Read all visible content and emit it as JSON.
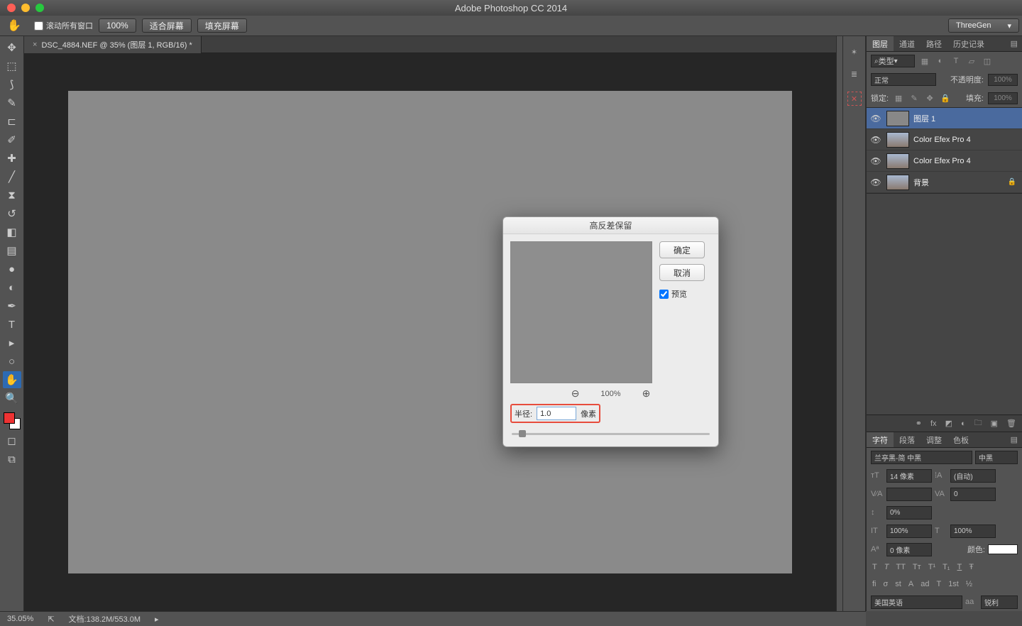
{
  "titlebar": {
    "app": "Adobe Photoshop CC 2014"
  },
  "optbar": {
    "scroll_all": "滚动所有窗口",
    "zoom": "100%",
    "fit": "适合屏幕",
    "fill": "填充屏幕",
    "workspace": "ThreeGen"
  },
  "tab": {
    "name": "DSC_4884.NEF @ 35% (图层 1, RGB/16) *"
  },
  "panels": {
    "layers": "图层",
    "channels": "通道",
    "paths": "路径",
    "history": "历史记录",
    "kind": "类型",
    "blend": "正常",
    "opacity_l": "不透明度:",
    "opacity_v": "100%",
    "lock": "锁定:",
    "fill_l": "填充:",
    "fill_v": "100%"
  },
  "layers": [
    {
      "name": "图层 1",
      "sel": true,
      "thumb": "gray"
    },
    {
      "name": "Color Efex Pro 4",
      "sel": false,
      "thumb": "img"
    },
    {
      "name": "Color Efex Pro 4",
      "sel": false,
      "thumb": "img"
    },
    {
      "name": "背景",
      "sel": false,
      "thumb": "img",
      "lock": true
    }
  ],
  "char": {
    "tab1": "字符",
    "tab2": "段落",
    "tab3": "调整",
    "tab4": "色板",
    "font": "兰亭黑-简 中黑",
    "style": "中黑",
    "size": "14 像素",
    "leading": "(自动)",
    "tracking": "0",
    "kerning": "",
    "vscale": "0%",
    "hscale": "100%",
    "vscale2": "100%",
    "baseline": "0 像素",
    "color_l": "颜色:",
    "lang": "美国英语",
    "aa": "aa",
    "sharp": "锐利"
  },
  "dialog": {
    "title": "高反差保留",
    "ok": "确定",
    "cancel": "取消",
    "preview": "预览",
    "zoom": "100%",
    "radius_l": "半径:",
    "radius_v": "1.0",
    "px": "像素"
  },
  "status": {
    "zoom": "35.05%",
    "doc": "文档:138.2M/553.0M"
  },
  "search_ph": "类型"
}
